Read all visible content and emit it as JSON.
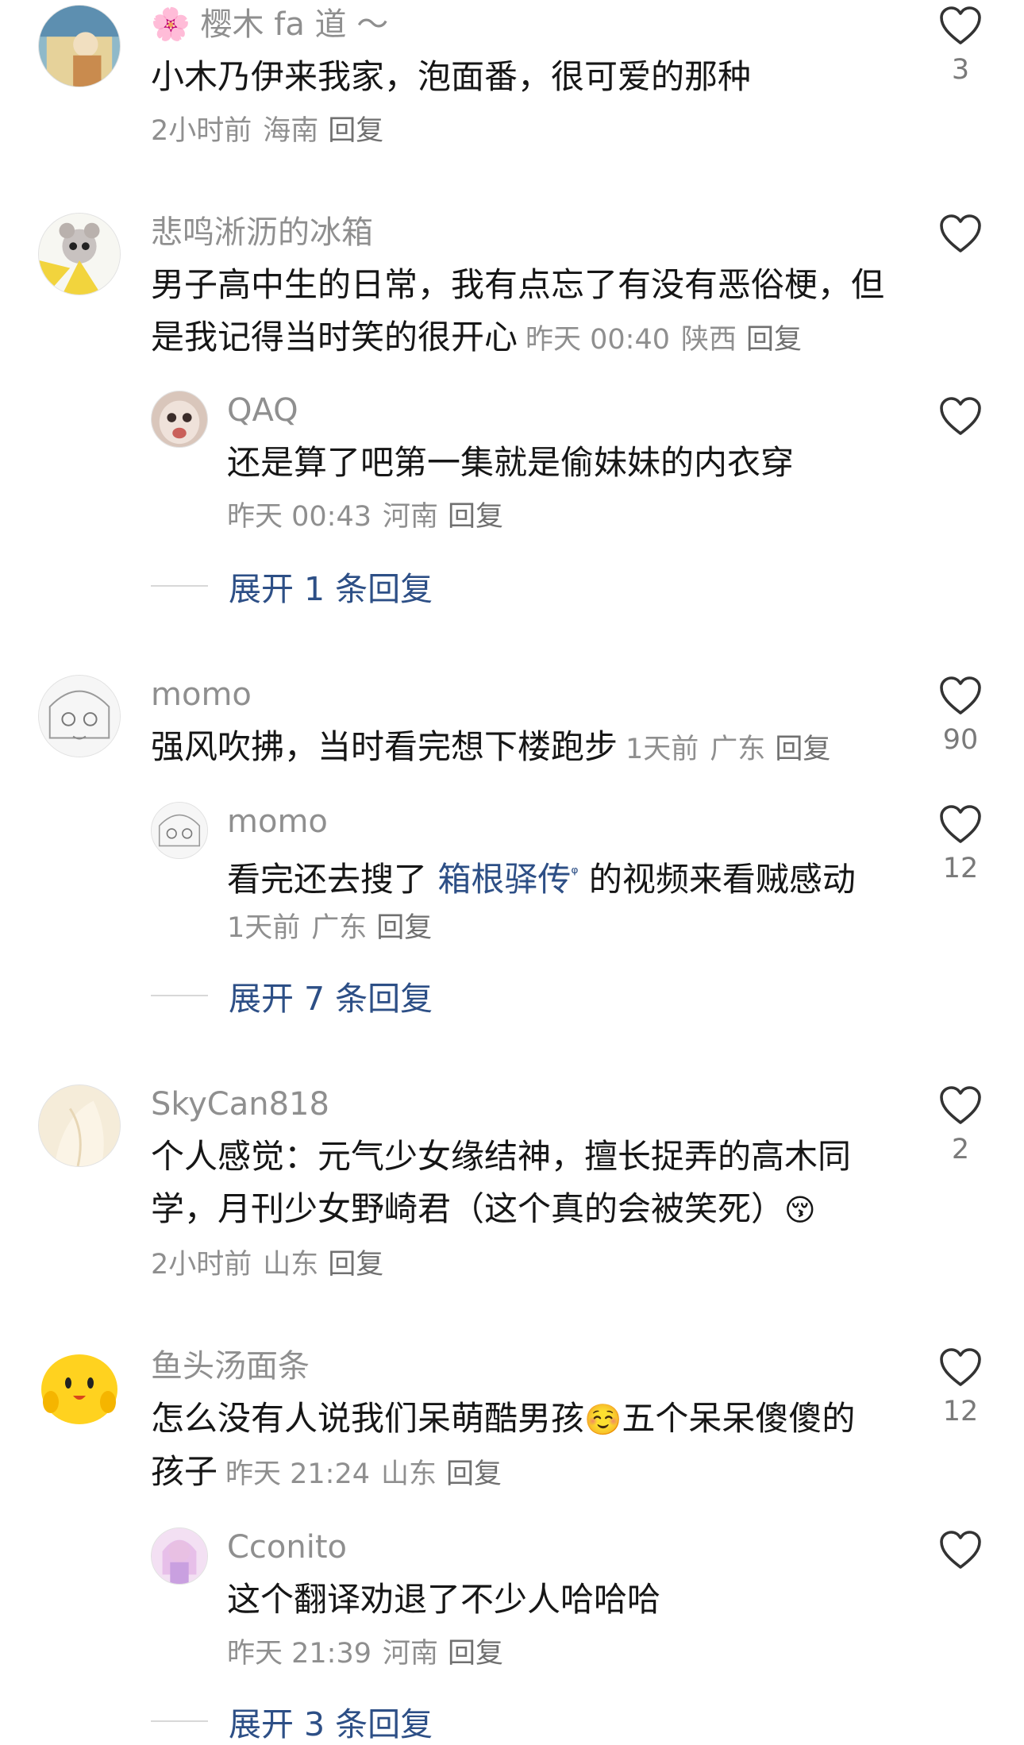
{
  "comments": [
    {
      "name": "🌸 樱木 fa 道 ～",
      "text": "小木乃伊来我家，泡面番，很可爱的那种",
      "time": "2小时前",
      "region": "海南",
      "reply_label": "回复",
      "likes": "3"
    },
    {
      "name": "悲鸣淅沥的冰箱",
      "text": "男子高中生的日常，我有点忘了有没有恶俗梗，但是我记得当时笑的很开心",
      "time": "昨天 00:40",
      "region": "陕西",
      "reply_label": "回复",
      "likes": "",
      "reply": {
        "name": "QAQ",
        "text": "还是算了吧第一集就是偷妹妹的内衣穿",
        "time": "昨天 00:43",
        "region": "河南",
        "reply_label": "回复",
        "likes": ""
      },
      "expand_label": "展开 1 条回复"
    },
    {
      "name": "momo",
      "text": "强风吹拂，当时看完想下楼跑步",
      "time": "1天前",
      "region": "广东",
      "reply_label": "回复",
      "likes": "90",
      "reply": {
        "name": "momo",
        "text_before": "看完还去搜了 ",
        "search_term": "箱根驿传",
        "search_icon": "ᵠ",
        "text_after": " 的视频来看贼感动",
        "time": "1天前",
        "region": "广东",
        "reply_label": "回复",
        "likes": "12"
      },
      "expand_label": "展开 7 条回复"
    },
    {
      "name": "SkyCan818",
      "text": "个人感觉：元气少女缘结神，擅长捉弄的高木同学，月刊少女野崎君（这个真的会被笑死）",
      "emoji": "😚",
      "time": "2小时前",
      "region": "山东",
      "reply_label": "回复",
      "likes": "2"
    },
    {
      "name": "鱼头汤面条",
      "text_before": "怎么没有人说我们呆萌酷男孩",
      "emoji": "☺️",
      "text_after": "五个呆呆傻傻的孩子",
      "time": "昨天 21:24",
      "region": "山东",
      "reply_label": "回复",
      "likes": "12",
      "reply": {
        "name": "Cconito",
        "text": "这个翻译劝退了不少人哈哈哈",
        "time": "昨天 21:39",
        "region": "河南",
        "reply_label": "回复",
        "likes": ""
      },
      "expand_label": "展开 3 条回复"
    }
  ],
  "colors": {
    "link": "#2d4f86",
    "meta": "#8f8f8f",
    "text": "#161616"
  }
}
